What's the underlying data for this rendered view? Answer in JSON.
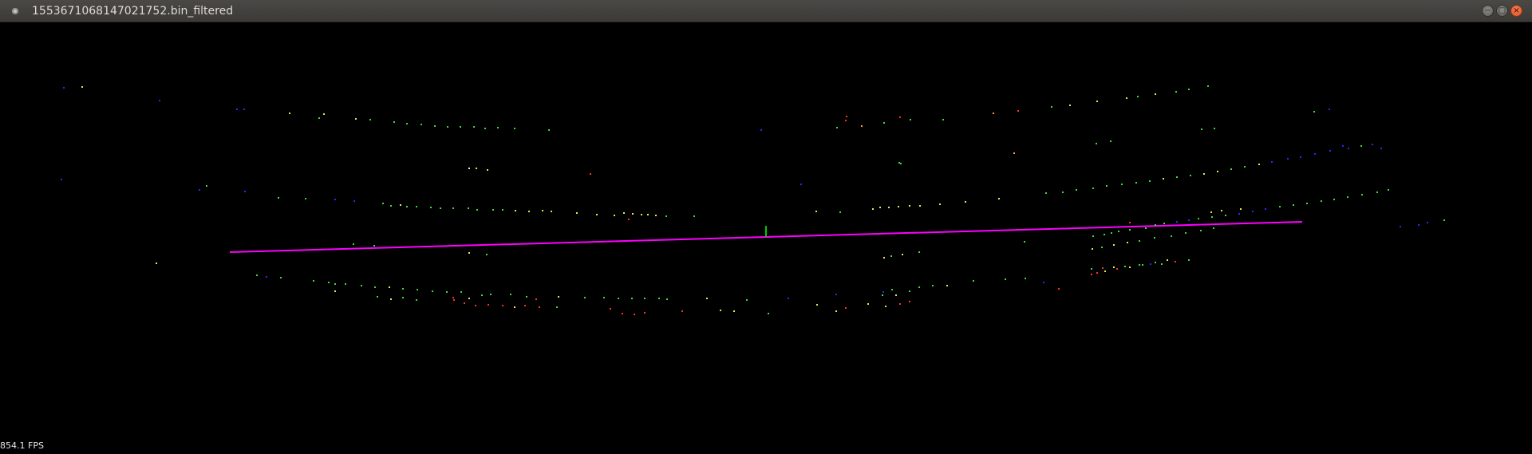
{
  "window": {
    "title": "1553671068147021752.bin_filtered",
    "minimize_icon": "minimize-icon",
    "maximize_icon": "maximize-icon",
    "close_icon": "close-icon",
    "app_icon": "window-menu-icon"
  },
  "status": {
    "fps_text": "854.1 FPS"
  },
  "colors": {
    "background": "#000000",
    "ground_line": "#ff00ff",
    "axis_marker": "#00cc00",
    "point_green": "#3ddc3d",
    "point_yellow": "#e8e84a",
    "point_blue": "#2a2aff",
    "point_red": "#ff3322",
    "point_orange": "#ff9933",
    "point_white": "#f0f0d0"
  }
}
